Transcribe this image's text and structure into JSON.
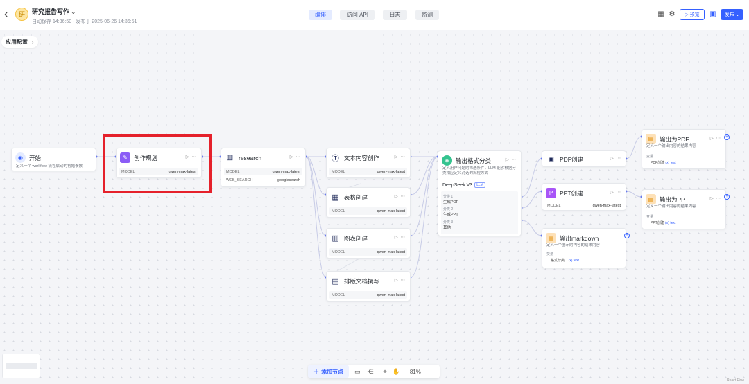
{
  "header": {
    "title": "研究报告写作",
    "title_caret": "⌄",
    "subtitle": "自动保存 14:36:50 · 发布于 2025-06-26 14:36:51",
    "logo_text": "研"
  },
  "tabs": [
    {
      "label": "编排",
      "active": true
    },
    {
      "label": "访问 API"
    },
    {
      "label": "日志"
    },
    {
      "label": "监测"
    }
  ],
  "actions": {
    "preview": "▷ 预览",
    "publish": "发布 ⌄"
  },
  "config_label": "应用配置",
  "config_arrow": "›",
  "nodes": {
    "start": {
      "title": "开始",
      "desc": "定义一个 workflow 流程启动的初始参数"
    },
    "plan": {
      "title": "创作规划",
      "model_key": "MODEL",
      "model_val": "qwen-max-latest"
    },
    "research": {
      "title": "research",
      "model_key": "MODEL",
      "model_val": "qwen-max-latest",
      "search_key": "WEB_SEARCH",
      "search_val": "googlesearch"
    },
    "text": {
      "title": "文本内容创作",
      "model_key": "MODEL",
      "model_val": "qwen-max-latest"
    },
    "table": {
      "title": "表格创建",
      "model_key": "MODEL",
      "model_val": "qwen-max-latest"
    },
    "chart": {
      "title": "图表创建",
      "model_key": "MODEL",
      "model_val": "qwen-max-latest"
    },
    "layout": {
      "title": "排版文档撰写",
      "model_key": "MODEL",
      "model_val": "qwen-max-latest"
    },
    "classify": {
      "title": "输出格式分类",
      "desc": "定义用户问题的筛选条件，LLM 能够根据分类相应定义对话的流程方式",
      "model": "DeepSeek V3",
      "model_tag": "LLM",
      "c1_label": "分类 1",
      "c1": "生成PDF",
      "c2_label": "分类 2",
      "c2": "生成PPT",
      "c3_label": "分类 3",
      "c3": "其他"
    },
    "pdf": {
      "title": "PDF创建"
    },
    "ppt": {
      "title": "PPT创建",
      "model_key": "MODEL",
      "model_val": "qwen-max-latest"
    },
    "md": {
      "title": "输出markdown",
      "desc": "定义一个图示的内容的结果内容",
      "var_label": "变量",
      "var_src": "格式分类...",
      "var_type": "(x) text"
    },
    "outpdf": {
      "title": "输出为PDF",
      "desc": "定义一个输出内容的结果内容",
      "var_label": "变量",
      "var_src": "PDF创建",
      "var_type": "(x) text"
    },
    "outppt": {
      "title": "输出为PPT",
      "desc": "定义一个输出内容的结果内容",
      "var_label": "变量",
      "var_src": "PPT创建",
      "var_type": "(x) text"
    }
  },
  "node_actions": "▷ ⋯",
  "toolbar": {
    "add_node": "添加节点",
    "zoom": "81%"
  },
  "brand": "React Flow"
}
